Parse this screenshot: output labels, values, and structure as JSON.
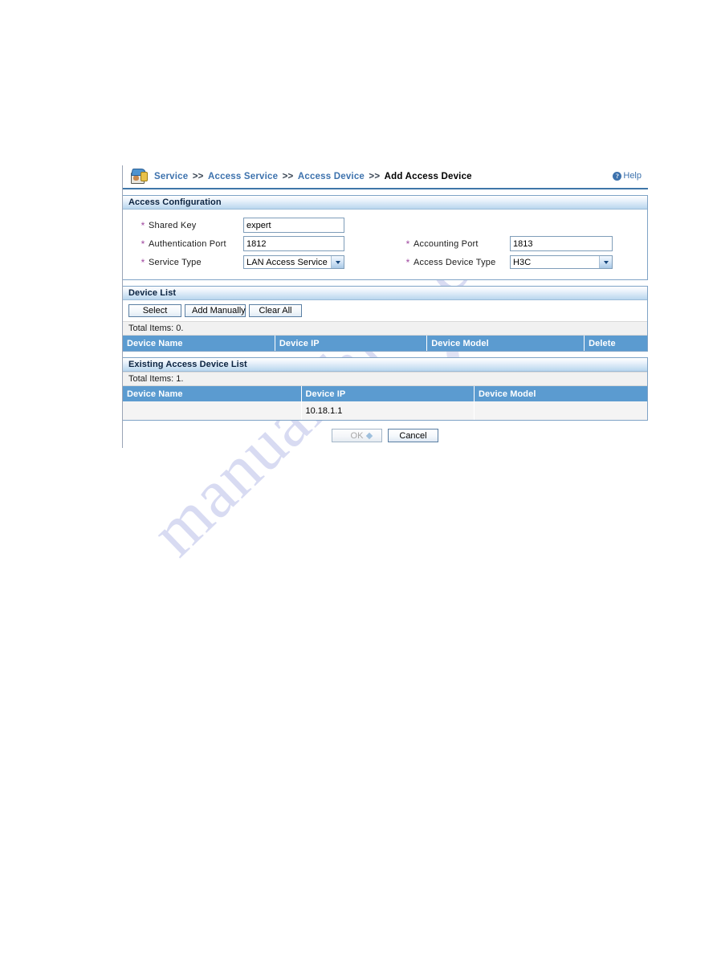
{
  "breadcrumb": {
    "icon": "device-user-key-icon",
    "items": [
      "Service",
      "Access Service",
      "Access Device"
    ],
    "separator": ">>",
    "current": "Add Access Device"
  },
  "help": {
    "icon": "help-question-icon",
    "label": "Help"
  },
  "access_configuration": {
    "title": "Access Configuration",
    "required_marker": "*",
    "fields": {
      "shared_key": {
        "label": "Shared Key",
        "value": "expert"
      },
      "authentication_port": {
        "label": "Authentication Port",
        "value": "1812"
      },
      "service_type": {
        "label": "Service Type",
        "value": "LAN Access Service"
      },
      "accounting_port": {
        "label": "Accounting Port",
        "value": "1813"
      },
      "access_device_type": {
        "label": "Access Device Type",
        "value": "H3C"
      }
    }
  },
  "device_list": {
    "title": "Device List",
    "buttons": {
      "select": "Select",
      "add_manually": "Add Manually",
      "clear_all": "Clear All"
    },
    "totals": "Total Items: 0.",
    "columns": [
      "Device Name",
      "Device IP",
      "Device Model",
      "Delete"
    ],
    "rows": []
  },
  "existing_access_device_list": {
    "title": "Existing Access Device List",
    "totals": "Total Items: 1.",
    "columns": [
      "Device Name",
      "Device IP",
      "Device Model"
    ],
    "rows": [
      {
        "device_name": "",
        "device_ip": "10.18.1.1",
        "device_model": ""
      }
    ]
  },
  "actions": {
    "ok": "OK",
    "cancel": "Cancel"
  },
  "watermark": {
    "text": "manualshive.com"
  },
  "colors": {
    "link": "#3d72ad",
    "panel_border": "#7fa3c6",
    "table_header": "#5b9bd0",
    "required_star": "#a048a0",
    "crumb_underline": "#3f76a8"
  }
}
